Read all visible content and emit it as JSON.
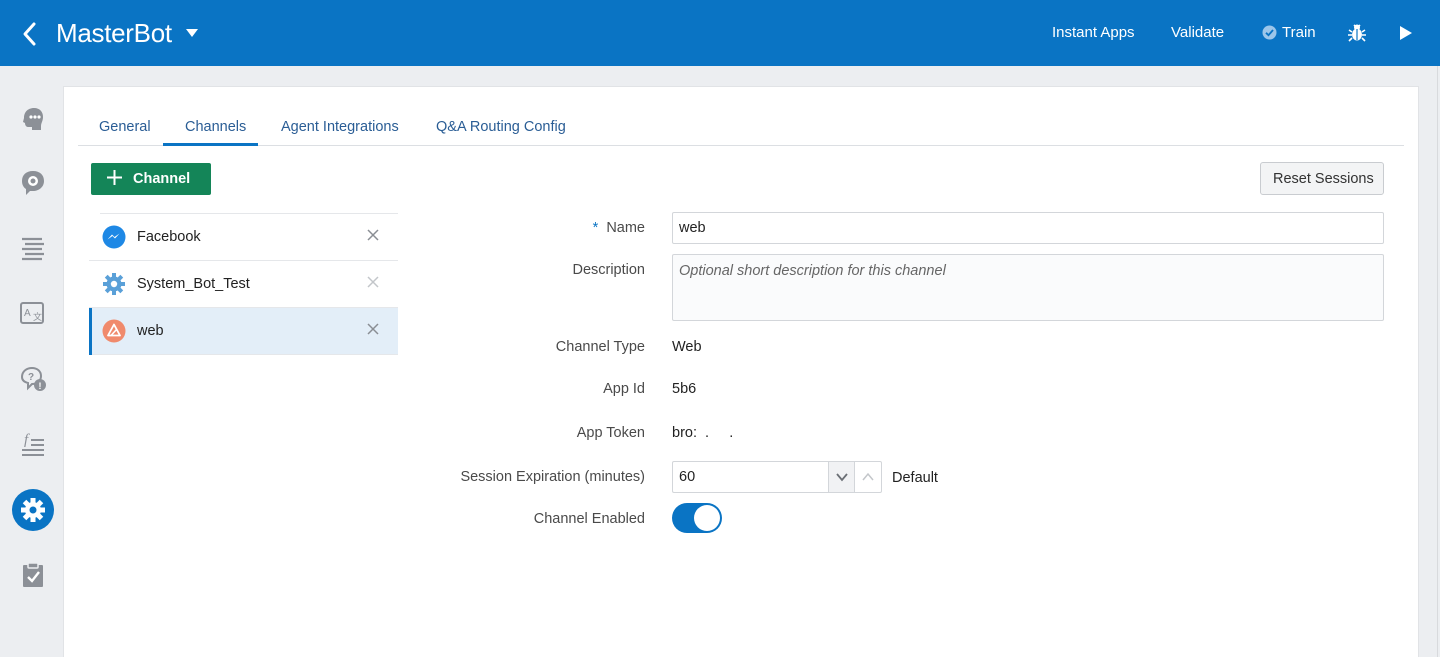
{
  "header": {
    "app_title": "MasterBot",
    "actions": {
      "instant_apps": "Instant Apps",
      "validate": "Validate",
      "train": "Train"
    },
    "bg_color": "#0a74c4"
  },
  "rail": {
    "icons": [
      "intents-icon",
      "entities-icon",
      "flows-icon",
      "resource-bundles-icon",
      "qna-icon",
      "components-icon",
      "settings-icon",
      "insights-icon"
    ],
    "active": "settings-icon"
  },
  "tabs": [
    {
      "label": "General"
    },
    {
      "label": "Channels",
      "active": true
    },
    {
      "label": "Agent Integrations"
    },
    {
      "label": "Q&A Routing Config"
    }
  ],
  "toolbar": {
    "add_channel_label": "Channel",
    "reset_sessions_label": "Reset Sessions"
  },
  "channels": [
    {
      "name": "Facebook",
      "icon": "messenger-icon"
    },
    {
      "name": "System_Bot_Test",
      "icon": "system-gear-icon"
    },
    {
      "name": "web",
      "icon": "web-channel-icon",
      "selected": true
    }
  ],
  "form": {
    "name": {
      "label": "Name",
      "required_mark": "*",
      "value": "web"
    },
    "description": {
      "label": "Description",
      "value": "",
      "placeholder": "Optional short description for this channel"
    },
    "channel_type": {
      "label": "Channel Type",
      "value": "Web"
    },
    "app_id": {
      "label": "App Id",
      "value": "5b6"
    },
    "app_token": {
      "label": "App Token",
      "value": "bro:  .     ."
    },
    "session_expiration": {
      "label": "Session Expiration (minutes)",
      "value": "60",
      "default_label": "Default"
    },
    "channel_enabled": {
      "label": "Channel Enabled",
      "value": true
    }
  },
  "colors": {
    "primary": "#0a74c4",
    "add_button": "#148558",
    "selected_row": "#e3eef8"
  }
}
